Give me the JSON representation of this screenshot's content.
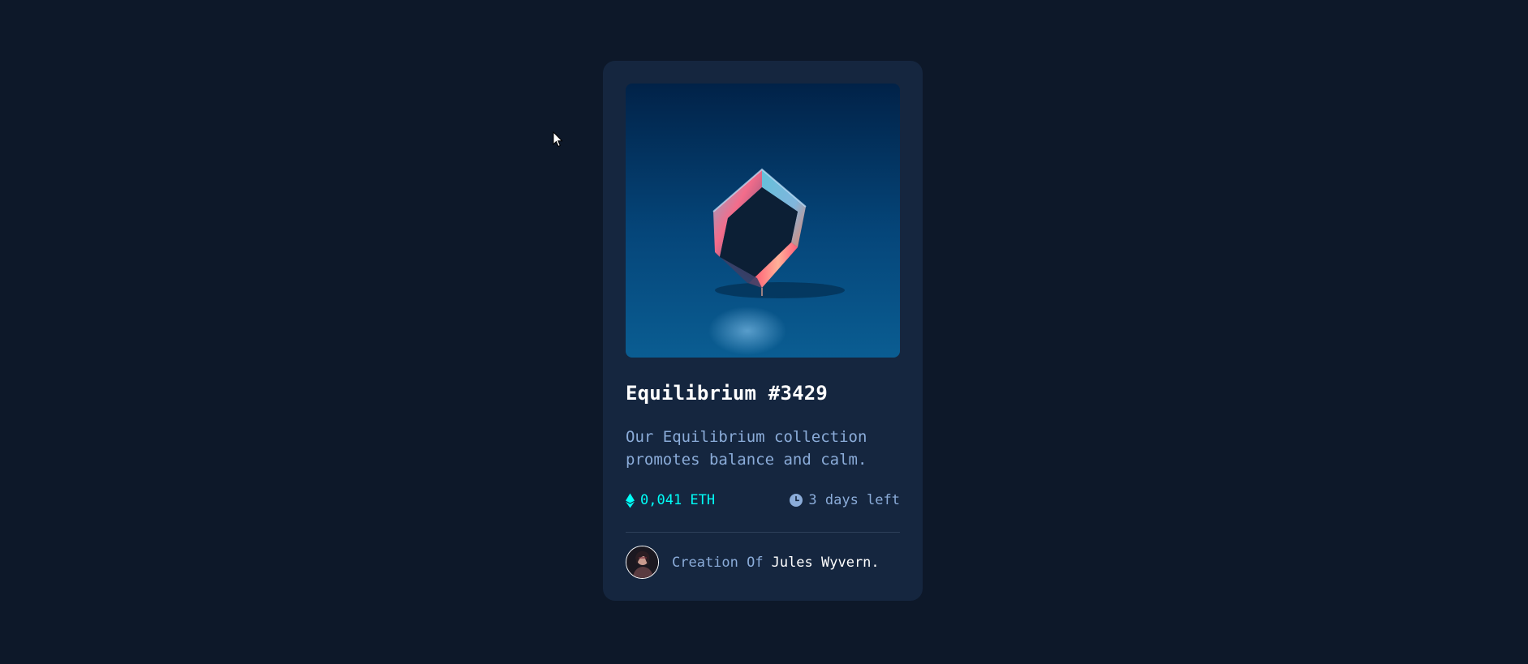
{
  "card": {
    "title": "Equilibrium #3429",
    "description": "Our Equilibrium collection promotes balance and calm.",
    "price": "0,041 ETH",
    "time_left": "3 days left",
    "creator_prefix": "Creation Of",
    "creator_name": "Jules Wyvern."
  },
  "icons": {
    "price": "ethereum-icon",
    "time": "clock-icon",
    "cursor": "mouse-pointer-icon"
  },
  "colors": {
    "page_bg": "#0d1829",
    "card_bg": "#15263f",
    "title": "#ffffff",
    "soft_blue": "#8bacd9",
    "cyan": "#00fff8",
    "divider": "#2e405a"
  }
}
